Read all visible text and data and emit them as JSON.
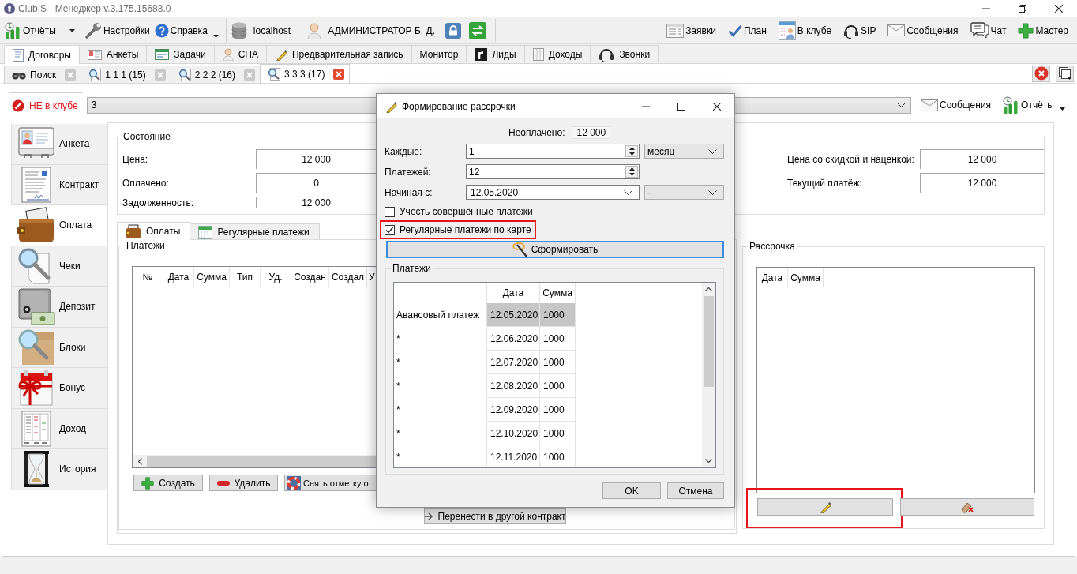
{
  "window": {
    "title": "ClubIS - Менеджер v.3.175.15683.0"
  },
  "toolbar": {
    "left": [
      {
        "label": "Отчёты",
        "kind": "split"
      },
      {
        "label": "Настройки",
        "kind": "plain"
      },
      {
        "label": "Справка",
        "kind": "dropdown"
      }
    ],
    "server": "localhost",
    "user": "АДМИНИСТРАТОР Б. Д.",
    "right": [
      "Заявки",
      "План",
      "В клубе",
      "SIP",
      "Сообщения",
      "Чат",
      "Мастер"
    ]
  },
  "module_tabs": [
    {
      "label": "Договоры",
      "selected": true
    },
    {
      "label": "Анкеты",
      "selected": false
    },
    {
      "label": "Задачи",
      "selected": false
    },
    {
      "label": "СПА",
      "selected": false
    },
    {
      "label": "Предварительная запись",
      "selected": false
    },
    {
      "label": "Монитор",
      "selected": false
    },
    {
      "label": "Лиды",
      "selected": false
    },
    {
      "label": "Доходы",
      "selected": false
    },
    {
      "label": "Звонки",
      "selected": false
    }
  ],
  "document_tabs": [
    {
      "label": "Поиск",
      "kind": "search",
      "selected": false
    },
    {
      "label": "1 1 1 (15)",
      "kind": "client",
      "selected": false
    },
    {
      "label": "2 2 2 (16)",
      "kind": "client",
      "selected": false
    },
    {
      "label": "3 3 3 (17)",
      "kind": "client",
      "selected": true
    }
  ],
  "client_bar": {
    "status": "НЕ в клубе",
    "client": "3",
    "buttons": [
      {
        "label": "Сообщения",
        "kind": "plain"
      },
      {
        "label": "Отчёты",
        "kind": "dropdown"
      }
    ]
  },
  "sidebar": {
    "items": [
      {
        "label": "Анкета",
        "selected": false
      },
      {
        "label": "Контракт",
        "selected": false
      },
      {
        "label": "Оплата",
        "selected": true
      },
      {
        "label": "Чеки",
        "selected": false
      },
      {
        "label": "Депозит",
        "selected": false
      },
      {
        "label": "Блоки",
        "selected": false
      },
      {
        "label": "Бонус",
        "selected": false
      },
      {
        "label": "Доход",
        "selected": false
      },
      {
        "label": "История",
        "selected": false
      }
    ]
  },
  "state": {
    "title": "Состояние",
    "left": [
      {
        "label": "Цена:",
        "value": "12 000"
      },
      {
        "label": "Оплачено:",
        "value": "0"
      },
      {
        "label": "Задолженность:",
        "value": "12 000"
      }
    ],
    "right": [
      {
        "label": "Цена со скидкой и наценкой:",
        "value": "12 000"
      },
      {
        "label": "Текущий платёж:",
        "value": "12 000"
      }
    ]
  },
  "payment_tabs": [
    {
      "label": "Оплаты",
      "selected": true
    },
    {
      "label": "Регулярные платежи",
      "selected": false
    }
  ],
  "payments": {
    "title": "Платежи",
    "columns": [
      "№",
      "Дата",
      "Сумма",
      "Тип",
      "Уд.",
      "Создан",
      "Создал",
      "У"
    ],
    "buttons": [
      {
        "label": "Создать",
        "kind": "add"
      },
      {
        "label": "Удалить",
        "kind": "remove"
      },
      {
        "label": "Снять отметку о",
        "kind": "unmark"
      }
    ],
    "transfer_button": "Перенести в другой контракт"
  },
  "installments": {
    "title": "Рассрочка",
    "columns": [
      "Дата",
      "Сумма"
    ],
    "buttons": [
      {
        "kind": "edit",
        "highlighted": true
      },
      {
        "kind": "clear",
        "highlighted": false
      }
    ]
  },
  "dialog": {
    "title": "Формирование рассрочки",
    "unpaid": {
      "label": "Неоплачено:",
      "value": "12 000"
    },
    "fields": [
      {
        "label": "Каждые:",
        "kind": "spin",
        "value": "1",
        "unit": "месяц"
      },
      {
        "label": "Платежей:",
        "kind": "spin",
        "value": "12"
      },
      {
        "label": "Начиная с:",
        "kind": "date",
        "value": "12.05.2020",
        "unit": "-"
      }
    ],
    "checkboxes": [
      {
        "label": "Учесть совершённые платежи",
        "checked": false,
        "highlighted": false
      },
      {
        "label": "Регулярные платежи по карте",
        "checked": true,
        "highlighted": true
      }
    ],
    "generate_button": "Сформировать",
    "schedule": {
      "title": "Платежи",
      "columns": [
        "Дата",
        "Сумма"
      ],
      "rows": [
        {
          "label": "Авансовый платеж",
          "date": "12.05.2020",
          "amount": "1000",
          "selected": true
        },
        {
          "label": "*",
          "date": "12.06.2020",
          "amount": "1000",
          "selected": false
        },
        {
          "label": "*",
          "date": "12.07.2020",
          "amount": "1000",
          "selected": false
        },
        {
          "label": "*",
          "date": "12.08.2020",
          "amount": "1000",
          "selected": false
        },
        {
          "label": "*",
          "date": "12.09.2020",
          "amount": "1000",
          "selected": false
        },
        {
          "label": "*",
          "date": "12.10.2020",
          "amount": "1000",
          "selected": false
        },
        {
          "label": "*",
          "date": "12.11.2020",
          "amount": "1000",
          "selected": false
        }
      ]
    },
    "buttons": [
      "OK",
      "Отмена"
    ]
  }
}
